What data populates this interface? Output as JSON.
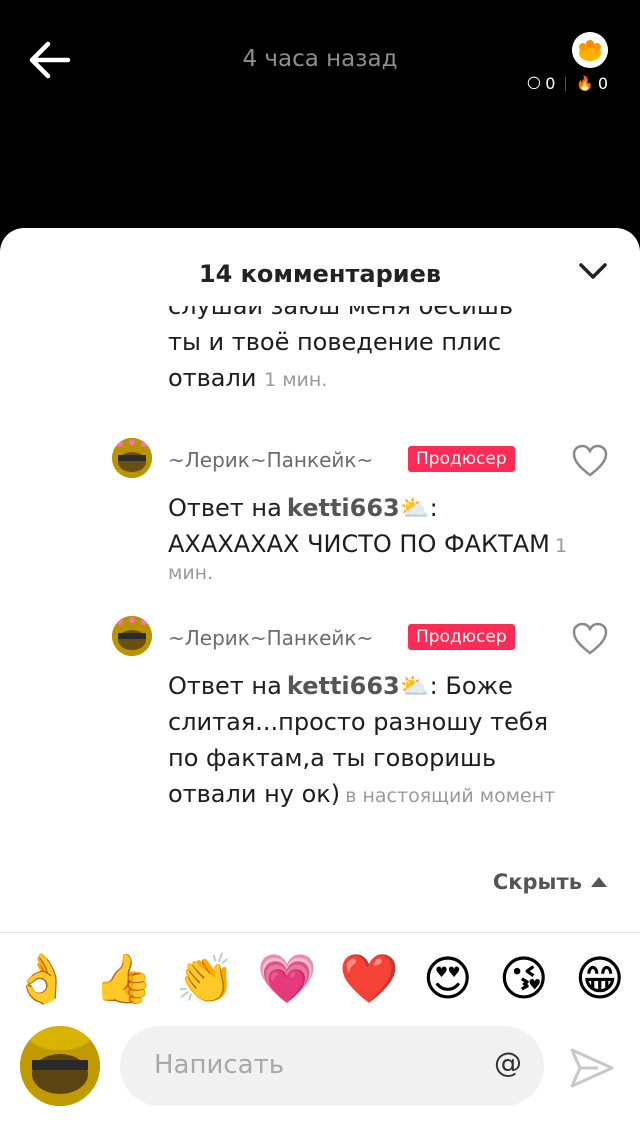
{
  "header": {
    "time": "4 часа назад",
    "stat_coins": "0",
    "stat_fire": "0"
  },
  "sheet": {
    "title": "14 комментариев",
    "clipped_comment_line1": "слушай заюш меня бесишь",
    "clipped_comment_line2": "ты и твоё поведение плис",
    "clipped_comment_line3": "отвали",
    "clipped_comment_time": "1 мин."
  },
  "comments": [
    {
      "author": "~Лерик~Панкейк~",
      "badge": "Продюсер",
      "reply_prefix": "Ответ на",
      "mention": "ketti663",
      "text_after": ": АХАХАХАХ ЧИСТО ПО ФАКТАМ",
      "time": "1 мин."
    },
    {
      "author": "~Лерик~Панкейк~",
      "badge": "Продюсер",
      "reply_prefix": "Ответ на",
      "mention": "ketti663",
      "text_after": ": Боже слитая...просто разношу тебя по фактам,а ты говоришь отвали ну ок)",
      "time": "в настоящий момент"
    }
  ],
  "hide_label": "Скрыть",
  "emojis": [
    "👌",
    "👍",
    "👏",
    "💗",
    "❤️",
    "😍",
    "😘",
    "😁",
    "😂"
  ],
  "input": {
    "placeholder": "Написать",
    "at_symbol": "@"
  },
  "colors": {
    "accent": "#fe2c55",
    "avatar_yellow": "#c09a00"
  }
}
